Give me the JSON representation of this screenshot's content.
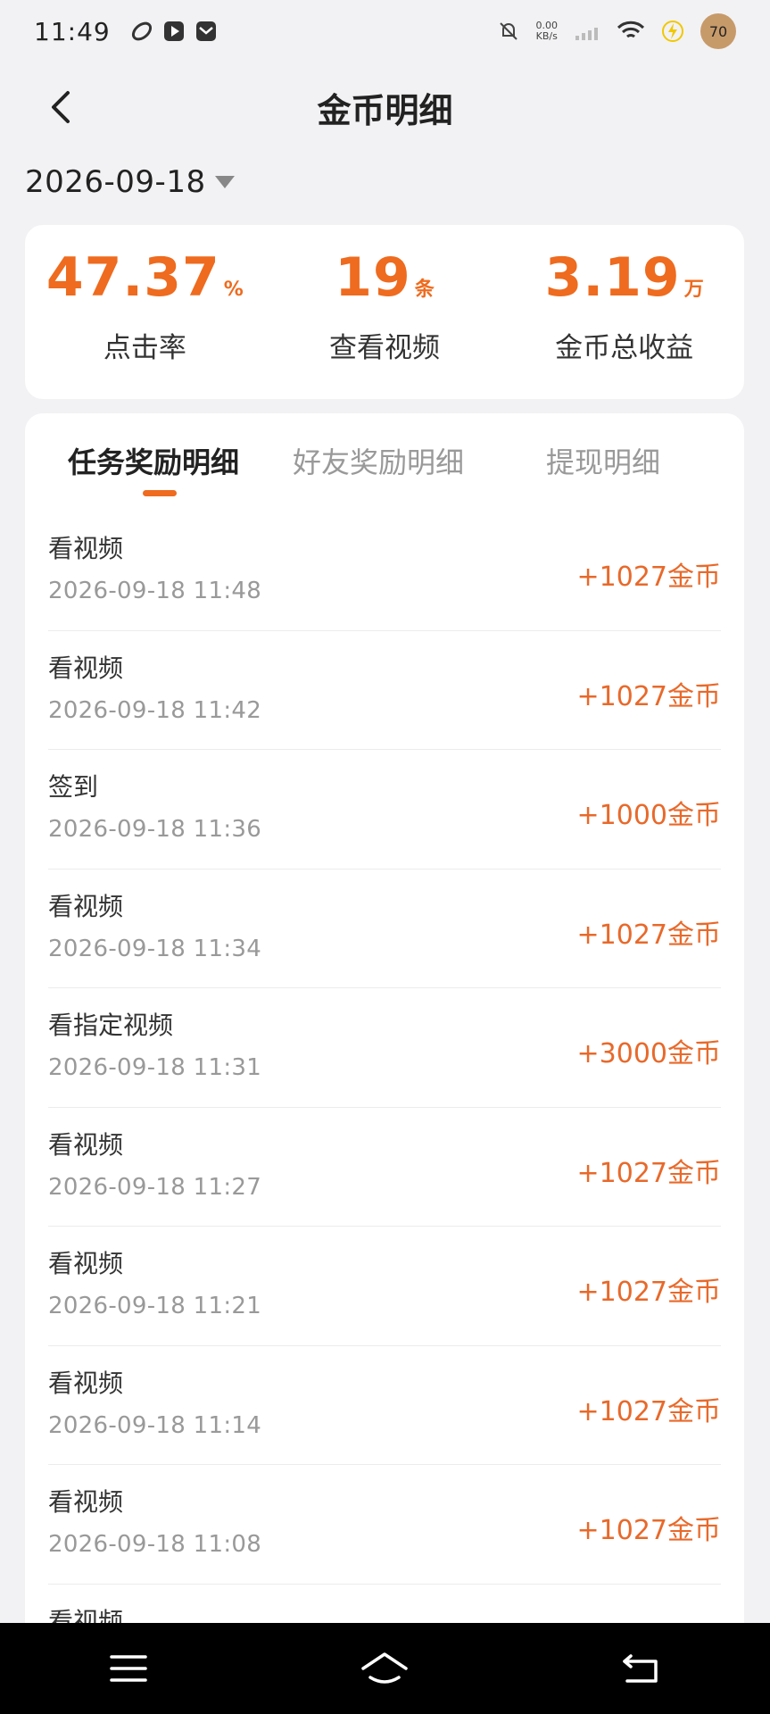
{
  "status_bar": {
    "time": "11:49",
    "net_speed_value": "0.00",
    "net_speed_unit": "KB/s",
    "battery": "70"
  },
  "header": {
    "title": "金币明细"
  },
  "date_selector": {
    "value": "2026-09-18"
  },
  "stats": [
    {
      "value": "47.37",
      "unit": "%",
      "label": "点击率"
    },
    {
      "value": "19",
      "unit": "条",
      "label": "查看视频"
    },
    {
      "value": "3.19",
      "unit": "万",
      "label": "金币总收益"
    }
  ],
  "tabs": [
    {
      "label": "任务奖励明细",
      "active": true
    },
    {
      "label": "好友奖励明细",
      "active": false
    },
    {
      "label": "提现明细",
      "active": false
    }
  ],
  "records": [
    {
      "title": "看视频",
      "time": "2026-09-18 11:48",
      "amount": "+1027金币"
    },
    {
      "title": "看视频",
      "time": "2026-09-18 11:42",
      "amount": "+1027金币"
    },
    {
      "title": "签到",
      "time": "2026-09-18 11:36",
      "amount": "+1000金币"
    },
    {
      "title": "看视频",
      "time": "2026-09-18 11:34",
      "amount": "+1027金币"
    },
    {
      "title": "看指定视频",
      "time": "2026-09-18 11:31",
      "amount": "+3000金币"
    },
    {
      "title": "看视频",
      "time": "2026-09-18 11:27",
      "amount": "+1027金币"
    },
    {
      "title": "看视频",
      "time": "2026-09-18 11:21",
      "amount": "+1027金币"
    },
    {
      "title": "看视频",
      "time": "2026-09-18 11:14",
      "amount": "+1027金币"
    },
    {
      "title": "看视频",
      "time": "2026-09-18 11:08",
      "amount": "+1027金币"
    },
    {
      "title": "看视频",
      "time": "",
      "amount": ""
    }
  ],
  "colors": {
    "accent": "#ee6b1f",
    "background": "#f2f2f4"
  }
}
